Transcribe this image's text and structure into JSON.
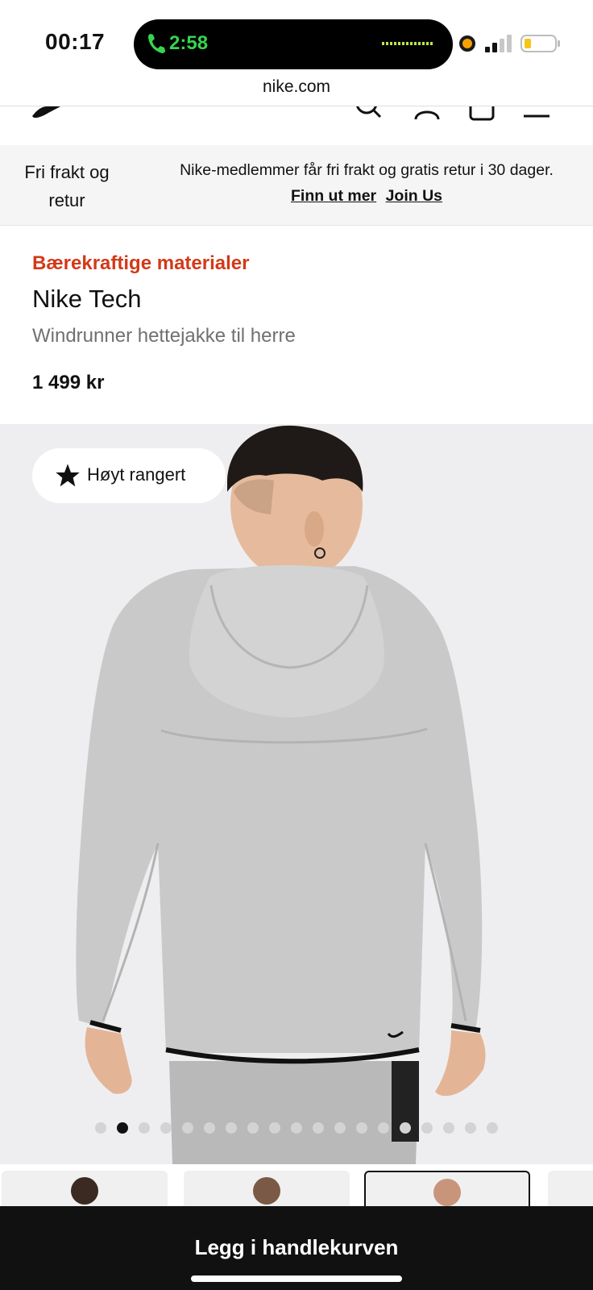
{
  "status_bar": {
    "time": "00:17",
    "call_timer": "2:58",
    "colors": {
      "call": "#35d44f",
      "recording": "#f6a100",
      "battery": "#f5c518"
    }
  },
  "browser": {
    "url": "nike.com"
  },
  "header": {
    "icons": [
      "nike-swoosh-logo",
      "search-icon",
      "profile-icon",
      "bag-icon",
      "menu-icon"
    ]
  },
  "promo": {
    "title": "Fri frakt og retur",
    "text": "Nike-medlemmer får fri frakt og gratis retur i 30 dager.",
    "link_learn_more": "Finn ut mer",
    "link_join": "Join Us"
  },
  "product": {
    "eyebrow": "Bærekraftige materialer",
    "name": "Nike Tech",
    "subtitle": "Windrunner hettejakke til herre",
    "price": "1 499 kr",
    "accent_color": "#d33918"
  },
  "gallery": {
    "badge": "Høyt rangert",
    "image_count": 19,
    "active_index": 1,
    "thumbnail_selected_index": 2
  },
  "cta": {
    "add_to_cart": "Legg i handlekurven"
  }
}
